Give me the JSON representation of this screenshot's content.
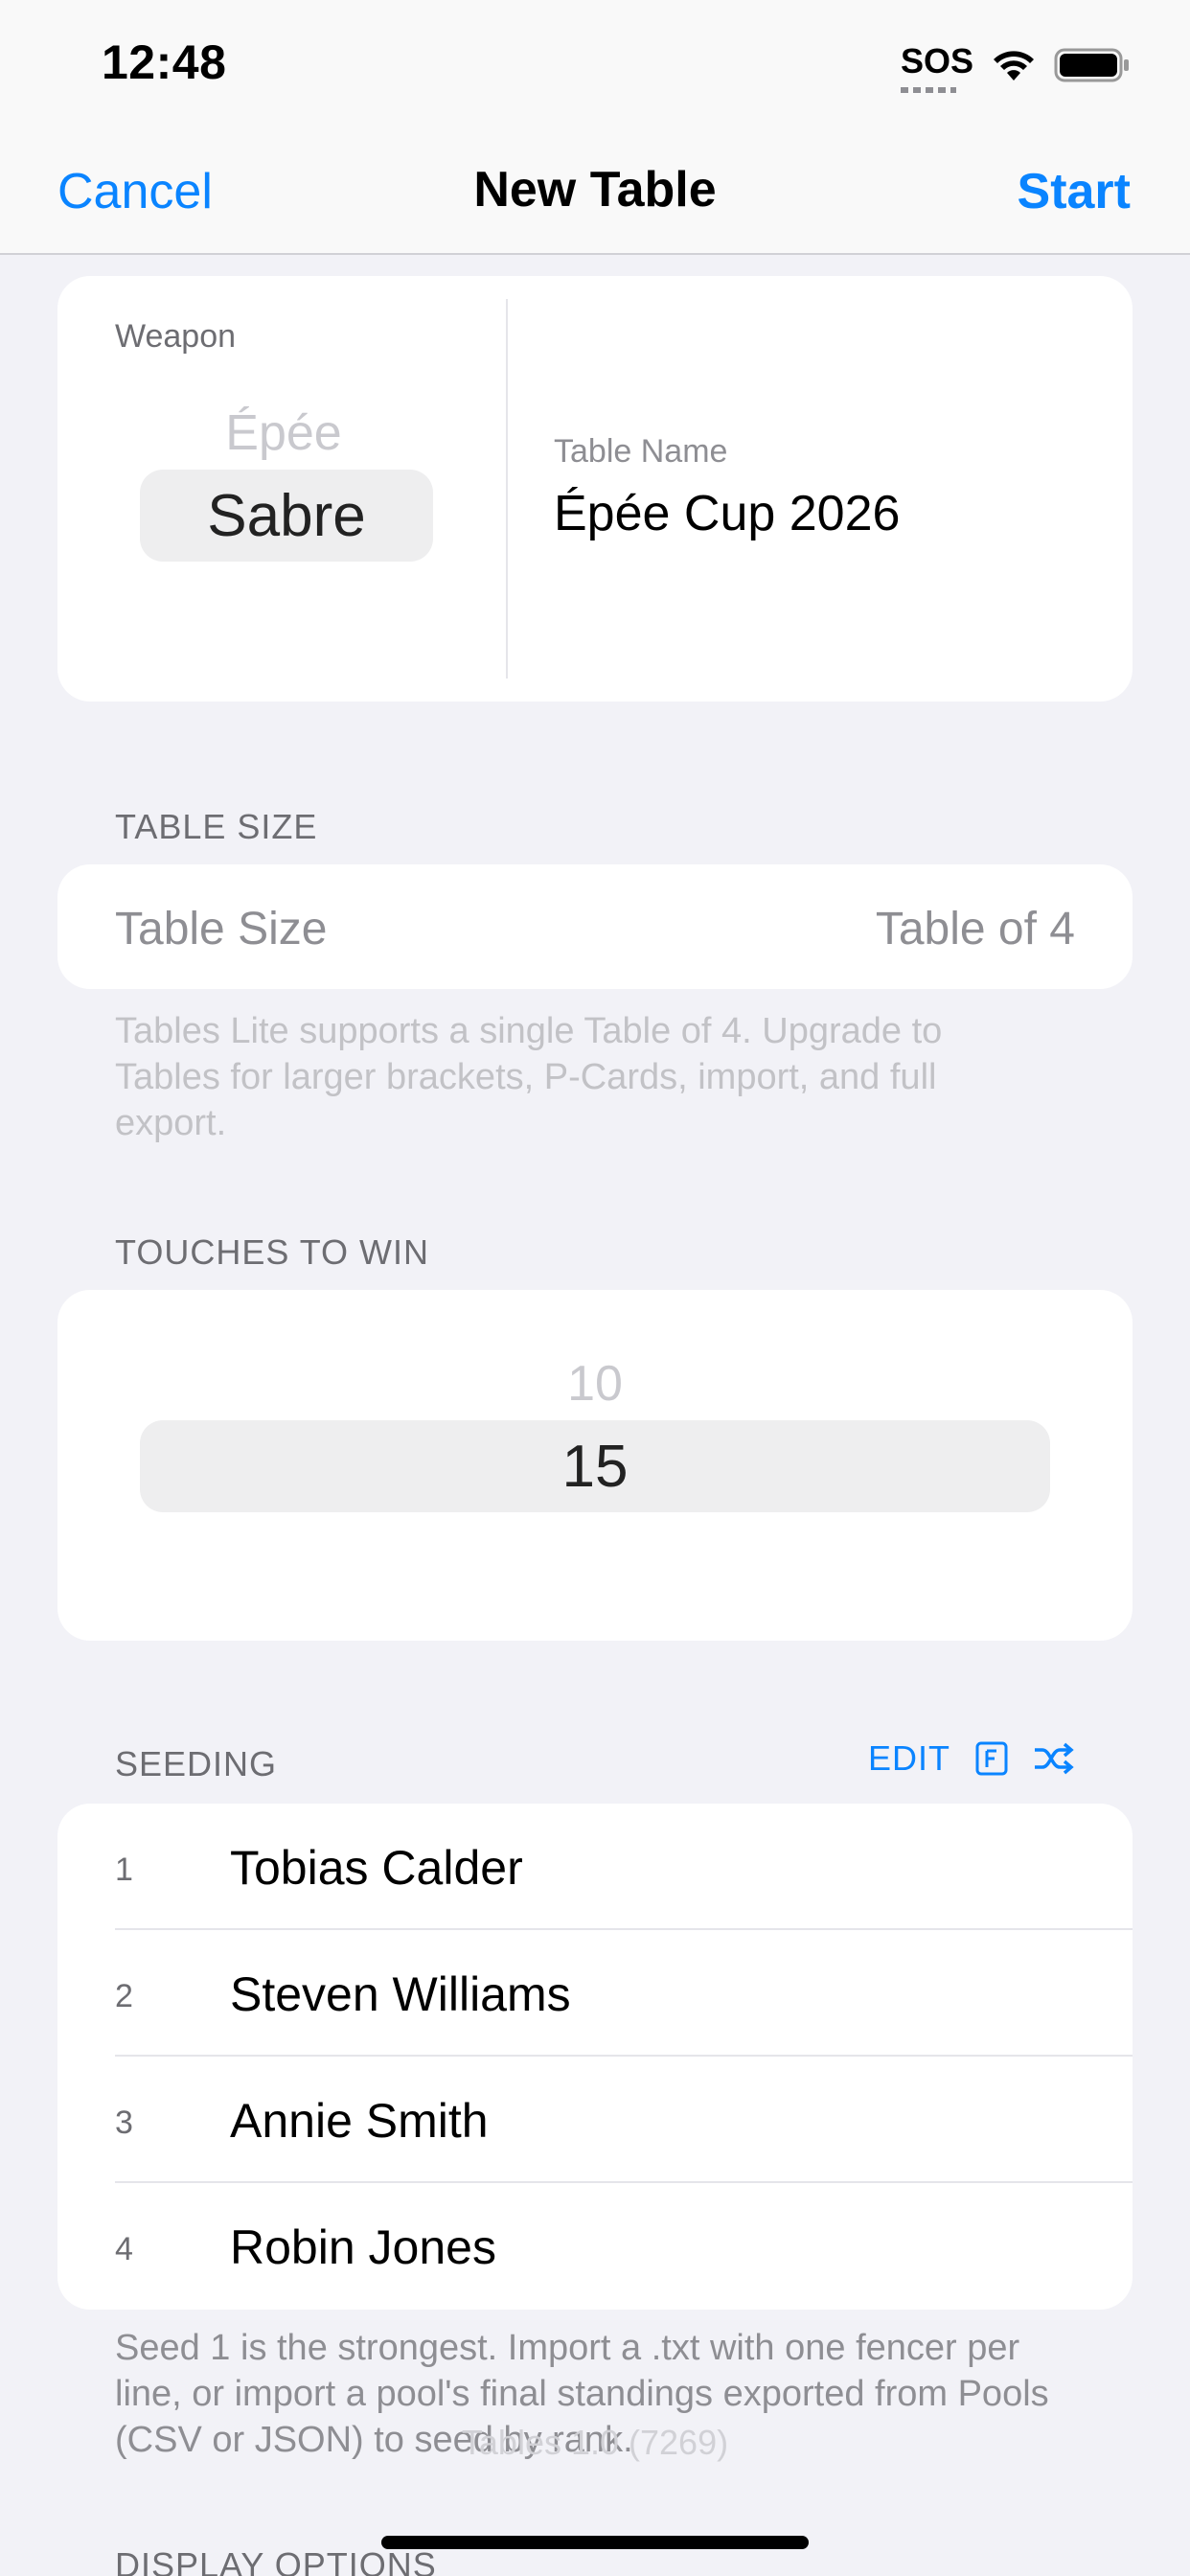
{
  "status_bar": {
    "time": "12:48",
    "sos": "SOS",
    "wifi_icon": "wifi-icon",
    "battery_icon": "battery-icon"
  },
  "nav": {
    "cancel_label": "Cancel",
    "title": "New Table",
    "start_label": "Start"
  },
  "weapon": {
    "label": "Weapon",
    "options_visible": [
      "Épée"
    ],
    "selected": "Sabre"
  },
  "table_name": {
    "label": "Table Name",
    "value": "Épée Cup 2026"
  },
  "table_size": {
    "header": "TABLE SIZE",
    "row_label": "Table Size",
    "row_value": "Table of 4",
    "footer": "Tables Lite supports a single Table of 4. Upgrade to Tables for larger brackets, P-Cards, import, and full export."
  },
  "touches": {
    "header": "TOUCHES TO WIN",
    "options_visible": [
      "10"
    ],
    "selected": "15"
  },
  "seeding": {
    "header": "SEEDING",
    "edit_label": "EDIT",
    "import_icon": "file-import-icon",
    "shuffle_icon": "shuffle-icon",
    "rows": [
      {
        "seed": "1",
        "name": "Tobias Calder"
      },
      {
        "seed": "2",
        "name": "Steven Williams"
      },
      {
        "seed": "3",
        "name": "Annie Smith"
      },
      {
        "seed": "4",
        "name": "Robin Jones"
      }
    ],
    "footer": "Seed 1 is the strongest. Import a .txt with one fencer per line, or import a pool's final standings exported from Pools (CSV or JSON) to seed by rank."
  },
  "display_options": {
    "header": "DISPLAY OPTIONS"
  },
  "version_text": "Tables 1.0 (7269)",
  "colors": {
    "accent": "#0a84ff",
    "background": "#f2f2f7",
    "card": "#ffffff"
  }
}
